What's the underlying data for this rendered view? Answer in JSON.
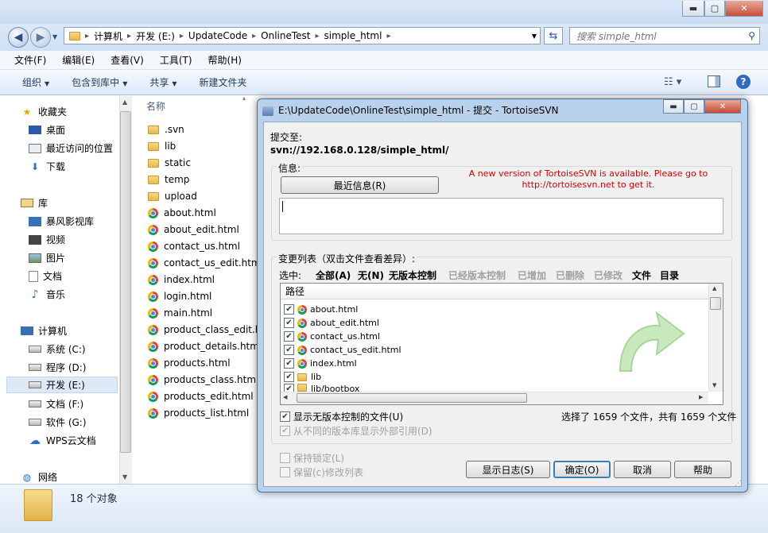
{
  "explorer": {
    "address": [
      "计算机",
      "开发 (E:)",
      "UpdateCode",
      "OnlineTest",
      "simple_html"
    ],
    "search_placeholder": "搜索 simple_html",
    "menu": [
      "文件(F)",
      "编辑(E)",
      "查看(V)",
      "工具(T)",
      "帮助(H)"
    ],
    "commands": [
      "组织",
      "包含到库中",
      "共享",
      "新建文件夹"
    ],
    "nav": {
      "favorites": "收藏夹",
      "desktop": "桌面",
      "recent": "最近访问的位置",
      "downloads": "下载",
      "libraries": "库",
      "storm": "暴风影视库",
      "video": "视频",
      "pictures": "图片",
      "documents": "文档",
      "music": "音乐",
      "computer": "计算机",
      "drive_c": "系统 (C:)",
      "drive_d": "程序 (D:)",
      "drive_e": "开发 (E:)",
      "drive_f": "文档 (F:)",
      "drive_g": "软件 (G:)",
      "wps": "WPS云文档",
      "network": "网络"
    },
    "column_name": "名称",
    "files": [
      ".svn",
      "lib",
      "static",
      "temp",
      "upload",
      "about.html",
      "about_edit.html",
      "contact_us.html",
      "contact_us_edit.html",
      "index.html",
      "login.html",
      "main.html",
      "product_class_edit.html",
      "product_details.html",
      "products.html",
      "products_class.html",
      "products_edit.html",
      "products_list.html"
    ],
    "status": "18 个对象"
  },
  "dialog": {
    "title": "E:\\UpdateCode\\OnlineTest\\simple_html - 提交 - TortoiseSVN",
    "commit_to_label": "提交至:",
    "commit_url": "svn://192.168.0.128/simple_html/",
    "message_label": "信息:",
    "recent_msg_button": "最近信息(R)",
    "notice_line1": "A new version of TortoiseSVN is available. Please go to",
    "notice_line2": "http://tortoisesvn.net to get it.",
    "changes_label": "变更列表（双击文件查看差异）:",
    "select_label": "选中:",
    "filters": [
      "全部(A)",
      "无(N)",
      "无版本控制",
      "已经版本控制",
      "已增加",
      "已删除",
      "已修改",
      "文件",
      "目录"
    ],
    "path_header": "路径",
    "entries": [
      "about.html",
      "about_edit.html",
      "contact_us.html",
      "contact_us_edit.html",
      "index.html",
      "lib",
      "lib/bootbox"
    ],
    "show_unversioned": "显示无版本控制的文件(U)",
    "show_externals": "从不同的版本库显示外部引用(D)",
    "selected_summary": "选择了 1659 个文件，共有 1659 个文件",
    "keep_locks": "保持锁定(L)",
    "keep_changelist": "保留(c)修改列表",
    "buttons": [
      "显示日志(S)",
      "确定(O)",
      "取消",
      "帮助"
    ]
  }
}
